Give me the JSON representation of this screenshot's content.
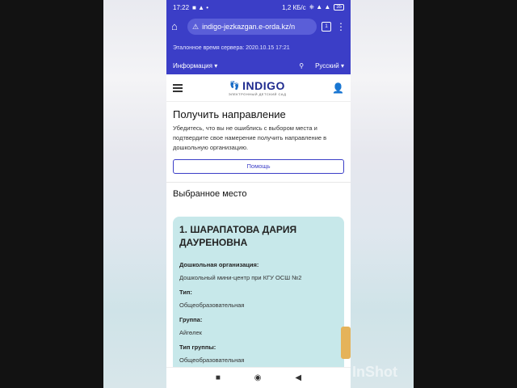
{
  "status": {
    "time": "17:22",
    "icons": "■ ▲ •",
    "net_speed": "1,2 КБ/с",
    "signal": "⎈ ▲ ▲",
    "battery": "35"
  },
  "browser": {
    "url": "indigo-jezkazgan.e-orda.kz/n",
    "tabs": "1"
  },
  "site": {
    "server_time": "Эталонное время сервера: 2020.10.15 17:21",
    "info_menu": "Информация",
    "language": "Русский",
    "logo": "INDIGO",
    "logo_sub": "ЭЛЕКТРОННЫЙ ДЕТСКИЙ САД"
  },
  "main": {
    "title": "Получить направление",
    "description": "Убедитесь, что вы не ошиблись с выбором места и подтвердите свое намерение получить направление в дошкольную организацию.",
    "help_button": "Помощь",
    "selected_heading": "Выбранное место"
  },
  "card": {
    "title": "1. ШАРАПАТОВА ДАРИЯ ДАУРЕНОВНА",
    "fields": [
      {
        "label": "Дошкольная организация:",
        "value": "Дошкольный мини-центр при КГУ ОСШ №2"
      },
      {
        "label": "Тип:",
        "value": "Общеобразовательная"
      },
      {
        "label": "Группа:",
        "value": "Айгөлек"
      },
      {
        "label": "Тип группы:",
        "value": "Общеобразовательная"
      }
    ]
  },
  "watermark": "InShot",
  "colors": {
    "primary": "#3b3ec7",
    "card": "#c7e8ea"
  }
}
